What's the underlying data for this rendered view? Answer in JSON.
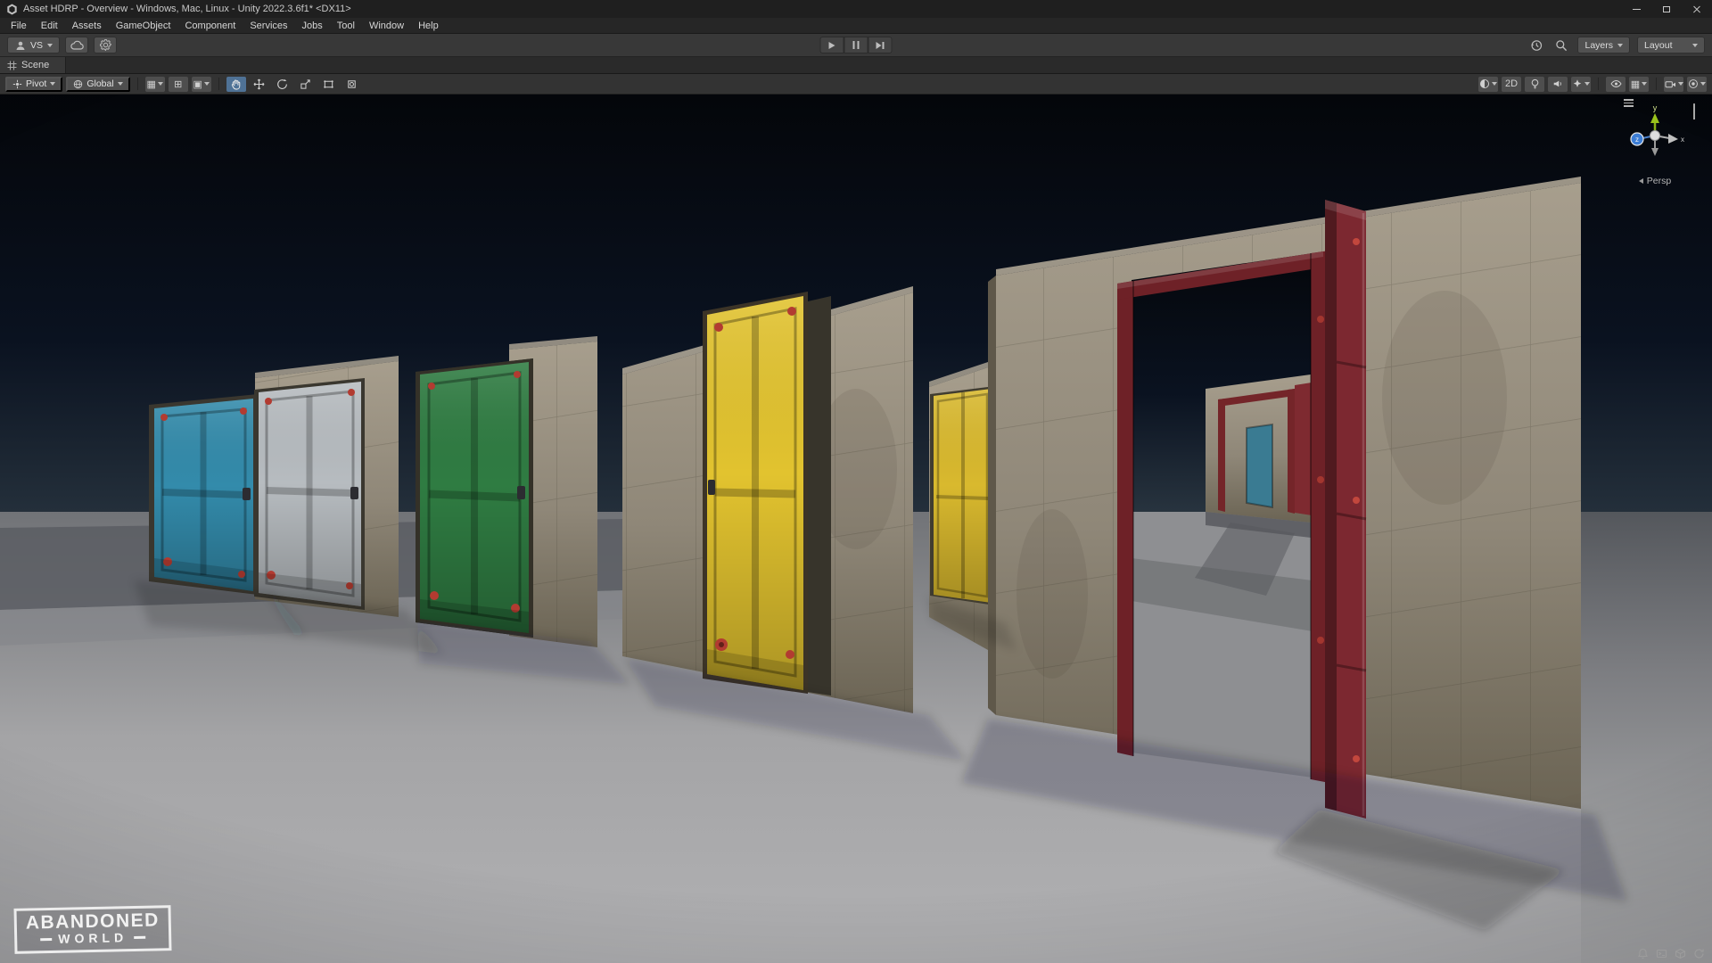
{
  "window": {
    "title": "Asset HDRP - Overview - Windows, Mac, Linux - Unity 2022.3.6f1* <DX11>"
  },
  "menubar": {
    "items": [
      "File",
      "Edit",
      "Assets",
      "GameObject",
      "Component",
      "Services",
      "Jobs",
      "Tool",
      "Window",
      "Help"
    ]
  },
  "toolbar": {
    "vs_label": "VS",
    "layers_label": "Layers",
    "layout_label": "Layout"
  },
  "tabs": {
    "scene_label": "Scene"
  },
  "scene_toolbar": {
    "pivot_label": "Pivot",
    "global_label": "Global",
    "mode_2d_label": "2D"
  },
  "viewport": {
    "gizmo": {
      "persp_label": "Persp",
      "axis_y": "y",
      "axis_z": "z",
      "axis_x": "x"
    },
    "watermark": {
      "line1": "ABANDONED",
      "line2": "WORLD"
    },
    "palette": {
      "sky_top": "#04060a",
      "sky_mid": "#0a1220",
      "sky_horizon": "#28343f",
      "ground_far": "#717377",
      "ground_mid": "#a4a4a6",
      "ground_near": "#b1b1b3",
      "concrete_light": "#a79e8d",
      "concrete_mid": "#8f8778",
      "concrete_dark": "#6b6454"
    },
    "doors": [
      {
        "name": "teal-door",
        "color": "#338bab"
      },
      {
        "name": "silver-door",
        "color": "#b7bcc0"
      },
      {
        "name": "green-door",
        "color": "#2f7c42"
      },
      {
        "name": "yellow-door",
        "color": "#e2c32f"
      },
      {
        "name": "yellow-door-far",
        "color": "#d9b92e"
      },
      {
        "name": "red-door-open",
        "color": "#7c2830"
      },
      {
        "name": "red-door-frame",
        "color": "#6e2127"
      }
    ]
  }
}
